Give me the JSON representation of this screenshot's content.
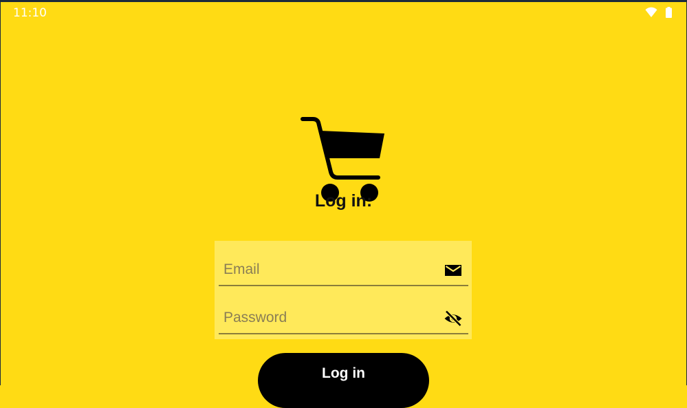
{
  "status_bar": {
    "time": "11:10",
    "wifi_icon": "wifi-icon",
    "battery_icon": "battery-icon"
  },
  "logo": {
    "icon": "shopping-cart-icon"
  },
  "title": "Log in:",
  "form": {
    "email": {
      "placeholder": "Email",
      "value": "",
      "icon": "mail-icon"
    },
    "password": {
      "placeholder": "Password",
      "value": "",
      "icon": "visibility-off-icon"
    }
  },
  "login_button": {
    "label": "Log in"
  },
  "colors": {
    "background": "#ffdb14",
    "form_background": "#ffe95a",
    "button": "#000000",
    "button_text": "#ffffff"
  }
}
